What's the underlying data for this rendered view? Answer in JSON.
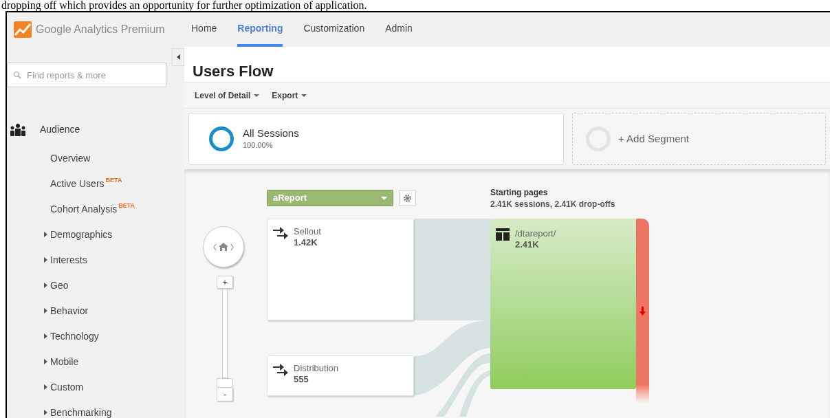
{
  "document_text": "dropping off which provides an opportunity for further optimization of application.",
  "header": {
    "product": "Google Analytics Premium",
    "tabs": [
      {
        "label": "Home",
        "selected": false
      },
      {
        "label": "Reporting",
        "selected": true
      },
      {
        "label": "Customization",
        "selected": false
      },
      {
        "label": "Admin",
        "selected": false
      }
    ]
  },
  "sidebar": {
    "search": {
      "placeholder": "Find reports & more"
    },
    "section": "Audience",
    "items": [
      {
        "label": "Overview",
        "kind": "link"
      },
      {
        "label": "Active Users",
        "kind": "link",
        "badge": "BETA"
      },
      {
        "label": "Cohort Analysis",
        "kind": "link",
        "badge": "BETA"
      },
      {
        "label": "Demographics",
        "kind": "group",
        "expanded": false
      },
      {
        "label": "Interests",
        "kind": "group",
        "expanded": false
      },
      {
        "label": "Geo",
        "kind": "group",
        "expanded": false
      },
      {
        "label": "Behavior",
        "kind": "group",
        "expanded": false
      },
      {
        "label": "Technology",
        "kind": "group",
        "expanded": false
      },
      {
        "label": "Mobile",
        "kind": "group",
        "expanded": false
      },
      {
        "label": "Custom",
        "kind": "group",
        "expanded": false
      },
      {
        "label": "Benchmarking",
        "kind": "group",
        "expanded": false
      }
    ]
  },
  "report": {
    "title": "Users Flow",
    "toolbar": [
      "Level of Detail",
      "Export"
    ],
    "segments": [
      {
        "kind": "segment",
        "label": "All Sessions",
        "share": "100.00%"
      },
      {
        "kind": "add",
        "label": "+ Add Segment"
      }
    ],
    "dimension": "aReport",
    "column_header": {
      "title": "Starting pages",
      "summary": "2.41K sessions, 2.41K drop-offs"
    },
    "nodes": [
      {
        "kind": "source",
        "label": "Sellout",
        "value": "1.42K"
      },
      {
        "kind": "source",
        "label": "Distribution",
        "value": "555"
      },
      {
        "kind": "page",
        "label": "/dtareport/",
        "value": "2.41K"
      }
    ],
    "zoom": {
      "plus": "+",
      "minus": "-"
    }
  }
}
